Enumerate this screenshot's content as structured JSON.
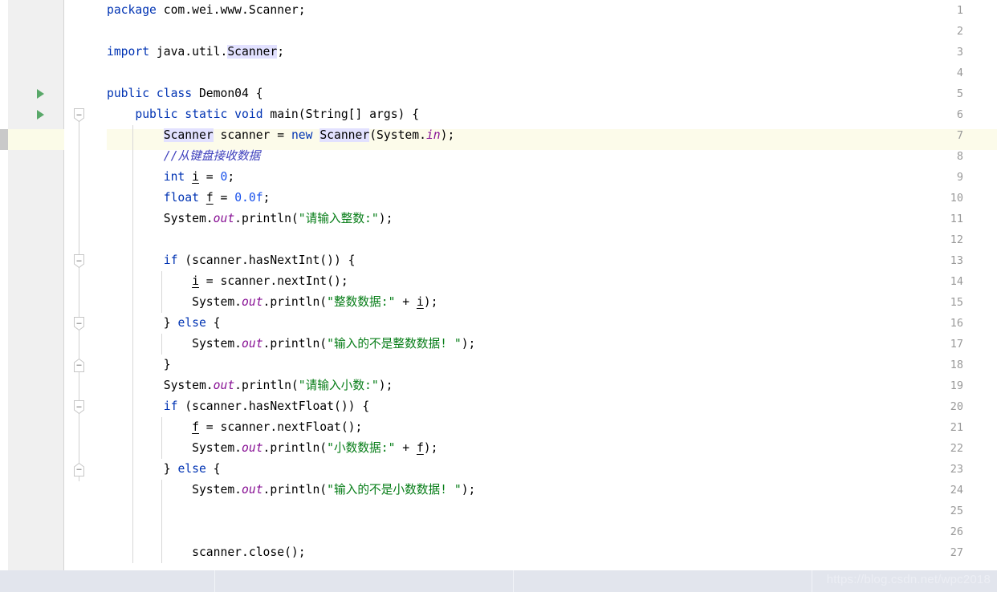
{
  "editor": {
    "current_line": 7,
    "colors": {
      "keyword": "#0033b3",
      "string": "#067d17",
      "number": "#1750eb",
      "comment": "#3d3fbc",
      "static_field": "#871094",
      "gutter_bg": "#f0f0f0",
      "current_line_bg": "#fcfbea",
      "occurrence_highlight": "#e2e1ff",
      "run_arrow": "#59a869",
      "statusbar_bg": "#e2e5ed"
    },
    "lines": [
      {
        "num": "1",
        "run_arrow": false,
        "fold": null,
        "indent_guides": 0,
        "tokens": [
          {
            "t": "package ",
            "c": "kw"
          },
          {
            "t": "com.wei.www.Scanner;",
            "c": "ident"
          }
        ]
      },
      {
        "num": "2",
        "run_arrow": false,
        "fold": null,
        "indent_guides": 0,
        "tokens": []
      },
      {
        "num": "3",
        "run_arrow": false,
        "fold": null,
        "indent_guides": 0,
        "tokens": [
          {
            "t": "import ",
            "c": "kw"
          },
          {
            "t": "java.util.",
            "c": "ident"
          },
          {
            "t": "Scanner",
            "c": "ident occ"
          },
          {
            "t": ";",
            "c": "ident"
          }
        ]
      },
      {
        "num": "4",
        "run_arrow": false,
        "fold": null,
        "indent_guides": 0,
        "tokens": []
      },
      {
        "num": "5",
        "run_arrow": true,
        "fold": null,
        "indent_guides": 0,
        "tokens": [
          {
            "t": "public class ",
            "c": "kw"
          },
          {
            "t": "Demon04 {",
            "c": "ident"
          }
        ]
      },
      {
        "num": "6",
        "run_arrow": true,
        "fold": "collapse-down",
        "indent_guides": 0,
        "tokens": [
          {
            "t": "    ",
            "c": "ident"
          },
          {
            "t": "public static void ",
            "c": "kw"
          },
          {
            "t": "main(String[] args) {",
            "c": "ident"
          }
        ]
      },
      {
        "num": "7",
        "run_arrow": false,
        "fold": null,
        "indent_guides": 1,
        "tokens": [
          {
            "t": "        ",
            "c": "ident"
          },
          {
            "t": "Scanner",
            "c": "ident occ"
          },
          {
            "t": " scanner = ",
            "c": "ident"
          },
          {
            "t": "new ",
            "c": "kw"
          },
          {
            "t": "Scanner",
            "c": "ident occ"
          },
          {
            "t": "(System.",
            "c": "ident"
          },
          {
            "t": "in",
            "c": "stat"
          },
          {
            "t": ");",
            "c": "ident"
          }
        ]
      },
      {
        "num": "8",
        "run_arrow": false,
        "fold": null,
        "indent_guides": 1,
        "tokens": [
          {
            "t": "        ",
            "c": "ident"
          },
          {
            "t": "//从键盘接收数据",
            "c": "cmt"
          }
        ]
      },
      {
        "num": "9",
        "run_arrow": false,
        "fold": null,
        "indent_guides": 1,
        "tokens": [
          {
            "t": "        ",
            "c": "ident"
          },
          {
            "t": "int ",
            "c": "kw"
          },
          {
            "t": "i",
            "c": "var"
          },
          {
            "t": " = ",
            "c": "ident"
          },
          {
            "t": "0",
            "c": "num"
          },
          {
            "t": ";",
            "c": "ident"
          }
        ]
      },
      {
        "num": "10",
        "run_arrow": false,
        "fold": null,
        "indent_guides": 1,
        "tokens": [
          {
            "t": "        ",
            "c": "ident"
          },
          {
            "t": "float ",
            "c": "kw"
          },
          {
            "t": "f",
            "c": "var"
          },
          {
            "t": " = ",
            "c": "ident"
          },
          {
            "t": "0.0f",
            "c": "num"
          },
          {
            "t": ";",
            "c": "ident"
          }
        ]
      },
      {
        "num": "11",
        "run_arrow": false,
        "fold": null,
        "indent_guides": 1,
        "tokens": [
          {
            "t": "        System.",
            "c": "ident"
          },
          {
            "t": "out",
            "c": "stat"
          },
          {
            "t": ".println(",
            "c": "ident"
          },
          {
            "t": "\"请输入整数:\"",
            "c": "str"
          },
          {
            "t": ");",
            "c": "ident"
          }
        ]
      },
      {
        "num": "12",
        "run_arrow": false,
        "fold": null,
        "indent_guides": 1,
        "tokens": []
      },
      {
        "num": "13",
        "run_arrow": false,
        "fold": "collapse-down",
        "indent_guides": 1,
        "tokens": [
          {
            "t": "        ",
            "c": "ident"
          },
          {
            "t": "if ",
            "c": "kw"
          },
          {
            "t": "(scanner.hasNextInt()) {",
            "c": "ident"
          }
        ]
      },
      {
        "num": "14",
        "run_arrow": false,
        "fold": null,
        "indent_guides": 2,
        "tokens": [
          {
            "t": "            ",
            "c": "ident"
          },
          {
            "t": "i",
            "c": "var"
          },
          {
            "t": " = scanner.nextInt();",
            "c": "ident"
          }
        ]
      },
      {
        "num": "15",
        "run_arrow": false,
        "fold": null,
        "indent_guides": 2,
        "tokens": [
          {
            "t": "            System.",
            "c": "ident"
          },
          {
            "t": "out",
            "c": "stat"
          },
          {
            "t": ".println(",
            "c": "ident"
          },
          {
            "t": "\"整数数据:\"",
            "c": "str"
          },
          {
            "t": " + ",
            "c": "ident"
          },
          {
            "t": "i",
            "c": "var"
          },
          {
            "t": ");",
            "c": "ident"
          }
        ]
      },
      {
        "num": "16",
        "run_arrow": false,
        "fold": "collapse-down",
        "indent_guides": 1,
        "tokens": [
          {
            "t": "        } ",
            "c": "ident"
          },
          {
            "t": "else ",
            "c": "kw"
          },
          {
            "t": "{",
            "c": "ident"
          }
        ]
      },
      {
        "num": "17",
        "run_arrow": false,
        "fold": null,
        "indent_guides": 2,
        "tokens": [
          {
            "t": "            System.",
            "c": "ident"
          },
          {
            "t": "out",
            "c": "stat"
          },
          {
            "t": ".println(",
            "c": "ident"
          },
          {
            "t": "\"输入的不是整数数据! \"",
            "c": "str"
          },
          {
            "t": ");",
            "c": "ident"
          }
        ]
      },
      {
        "num": "18",
        "run_arrow": false,
        "fold": "collapse-up",
        "indent_guides": 1,
        "tokens": [
          {
            "t": "        }",
            "c": "ident"
          }
        ]
      },
      {
        "num": "19",
        "run_arrow": false,
        "fold": null,
        "indent_guides": 1,
        "tokens": [
          {
            "t": "        System.",
            "c": "ident"
          },
          {
            "t": "out",
            "c": "stat"
          },
          {
            "t": ".println(",
            "c": "ident"
          },
          {
            "t": "\"请输入小数:\"",
            "c": "str"
          },
          {
            "t": ");",
            "c": "ident"
          }
        ]
      },
      {
        "num": "20",
        "run_arrow": false,
        "fold": "collapse-down",
        "indent_guides": 1,
        "tokens": [
          {
            "t": "        ",
            "c": "ident"
          },
          {
            "t": "if ",
            "c": "kw"
          },
          {
            "t": "(scanner.hasNextFloat()) {",
            "c": "ident"
          }
        ]
      },
      {
        "num": "21",
        "run_arrow": false,
        "fold": null,
        "indent_guides": 2,
        "tokens": [
          {
            "t": "            ",
            "c": "ident"
          },
          {
            "t": "f",
            "c": "var"
          },
          {
            "t": " = scanner.nextFloat();",
            "c": "ident"
          }
        ]
      },
      {
        "num": "22",
        "run_arrow": false,
        "fold": null,
        "indent_guides": 2,
        "tokens": [
          {
            "t": "            System.",
            "c": "ident"
          },
          {
            "t": "out",
            "c": "stat"
          },
          {
            "t": ".println(",
            "c": "ident"
          },
          {
            "t": "\"小数数据:\"",
            "c": "str"
          },
          {
            "t": " + ",
            "c": "ident"
          },
          {
            "t": "f",
            "c": "var"
          },
          {
            "t": ");",
            "c": "ident"
          }
        ]
      },
      {
        "num": "23",
        "run_arrow": false,
        "fold": "collapse-up",
        "indent_guides": 1,
        "tokens": [
          {
            "t": "        } ",
            "c": "ident"
          },
          {
            "t": "else ",
            "c": "kw"
          },
          {
            "t": "{",
            "c": "ident"
          }
        ]
      },
      {
        "num": "24",
        "run_arrow": false,
        "fold": null,
        "indent_guides": 2,
        "tokens": [
          {
            "t": "            System.",
            "c": "ident"
          },
          {
            "t": "out",
            "c": "stat"
          },
          {
            "t": ".println(",
            "c": "ident"
          },
          {
            "t": "\"输入的不是小数数据! \"",
            "c": "str"
          },
          {
            "t": ");",
            "c": "ident"
          }
        ]
      },
      {
        "num": "25",
        "run_arrow": false,
        "fold": null,
        "indent_guides": 2,
        "tokens": []
      },
      {
        "num": "26",
        "run_arrow": false,
        "fold": null,
        "indent_guides": 2,
        "tokens": []
      },
      {
        "num": "27",
        "run_arrow": false,
        "fold": null,
        "indent_guides": 2,
        "tokens": [
          {
            "t": "            scanner.close();",
            "c": "ident"
          }
        ]
      }
    ]
  },
  "statusbar": {
    "segments": [
      268,
      372,
      372
    ],
    "watermark": "https://blog.csdn.net/wpc2018"
  }
}
